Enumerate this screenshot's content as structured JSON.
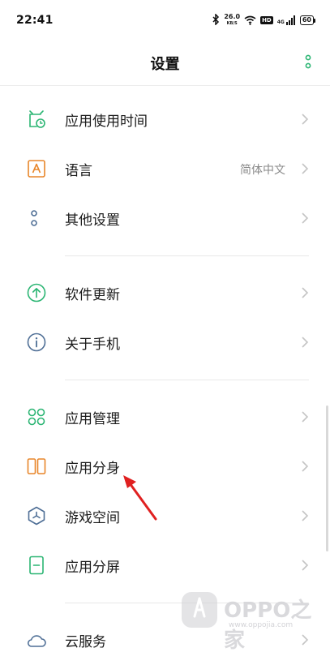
{
  "status": {
    "time": "22:41",
    "speed_value": "26.0",
    "speed_unit": "KB/S",
    "hd": "HD",
    "network": "4G",
    "battery": "60"
  },
  "header": {
    "title": "设置"
  },
  "groups": [
    [
      {
        "label": "应用使用时间",
        "icon": "app-usage-timer-icon"
      },
      {
        "label": "语言",
        "value": "简体中文",
        "icon": "language-icon"
      },
      {
        "label": "其他设置",
        "icon": "more-settings-icon"
      }
    ],
    [
      {
        "label": "软件更新",
        "icon": "software-update-icon"
      },
      {
        "label": "关于手机",
        "icon": "info-icon"
      }
    ],
    [
      {
        "label": "应用管理",
        "icon": "app-management-icon"
      },
      {
        "label": "应用分身",
        "icon": "app-clone-icon"
      },
      {
        "label": "游戏空间",
        "icon": "game-space-icon"
      },
      {
        "label": "应用分屏",
        "icon": "split-screen-icon"
      }
    ],
    [
      {
        "label": "云服务",
        "icon": "cloud-icon"
      }
    ]
  ],
  "watermark": {
    "brand": "OPPO之家",
    "url": "www.oppojia.com"
  },
  "colors": {
    "accent_green": "#2bb573",
    "orange": "#e8862a",
    "blue_gray": "#4f6f96",
    "chevron": "#c4c4c4"
  }
}
